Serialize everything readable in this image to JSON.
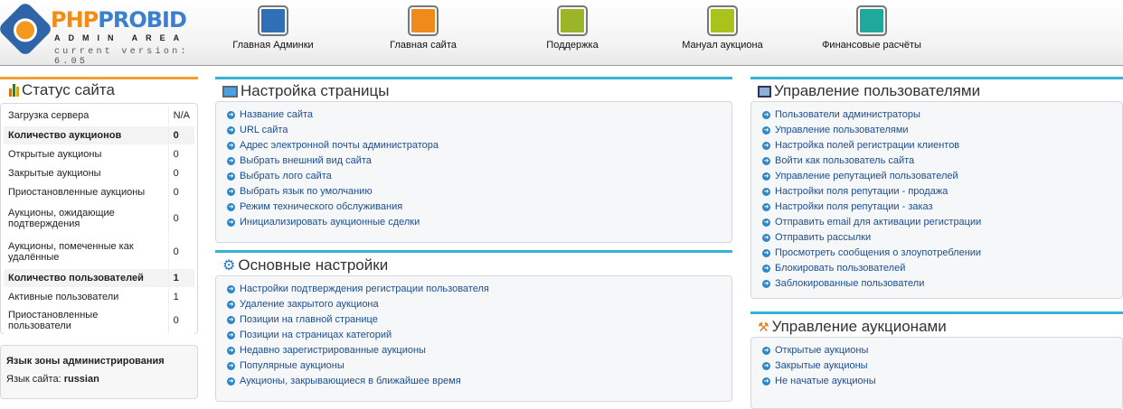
{
  "logo": {
    "brand_a": "PHP",
    "brand_b": "PROBID",
    "subtitle": "ADMIN AREA",
    "version": "current version: 6.05"
  },
  "nav": [
    {
      "label": "Главная Админки",
      "icon": "admin-user-icon",
      "color": "#2f6fb5"
    },
    {
      "label": "Главная сайта",
      "icon": "site-tools-icon",
      "color": "#f08a1a"
    },
    {
      "label": "Поддержка",
      "icon": "support-icon",
      "color": "#9bb52a"
    },
    {
      "label": "Мануал аукциона",
      "icon": "manual-bulb-icon",
      "color": "#a9c21c"
    },
    {
      "label": "Финансовые расчёты",
      "icon": "finance-bag-icon",
      "color": "#1fa99a"
    }
  ],
  "status": {
    "title": "Статус сайта",
    "rows": [
      {
        "label": "Загрузка сервера",
        "value": "N/A",
        "bold": false
      },
      {
        "label": "Количество аукционов",
        "value": "0",
        "bold": true
      },
      {
        "label": "Открытые аукционы",
        "value": "0",
        "bold": false
      },
      {
        "label": "Закрытые аукционы",
        "value": "0",
        "bold": false
      },
      {
        "label": "Приостановленные аукционы",
        "value": "0",
        "bold": false
      },
      {
        "label": "Аукционы, ожидающие подтверждения",
        "value": "0",
        "bold": false
      },
      {
        "label": "Аукционы, помеченные как удалённые",
        "value": "0",
        "bold": false
      },
      {
        "label": "Количество пользователей",
        "value": "1",
        "bold": true
      },
      {
        "label": "Активные пользователи",
        "value": "1",
        "bold": false
      },
      {
        "label": "Приостановленные пользователи",
        "value": "0",
        "bold": false
      }
    ]
  },
  "language": {
    "title": "Язык зоны администрирования",
    "label": "Язык сайта:",
    "value": "russian"
  },
  "page_setup": {
    "title": "Настройка страницы",
    "items": [
      "Название сайта",
      "URL сайта",
      "Адрес электронной почты администратора",
      "Выбрать внешний вид сайта",
      "Выбрать лого сайта",
      "Выбрать язык по умолчанию",
      "Режим технического обслуживания",
      "Инициализировать аукционные сделки"
    ]
  },
  "main_settings": {
    "title": "Основные настройки",
    "items": [
      "Настройки подтверждения регистрации пользователя",
      "Удаление закрытого аукциона",
      "Позиции на главной странице",
      "Позиции на страницах категорий",
      "Недавно зарегистрированные аукционы",
      "Популярные аукционы",
      "Аукционы, закрывающиеся в ближайшее время"
    ]
  },
  "users": {
    "title": "Управление пользователями",
    "items": [
      "Пользователи администраторы",
      "Управление пользователями",
      "Настройка полей регистрации клиентов",
      "Войти как пользователь сайта",
      "Управление репутацией пользователей",
      "Настройки поля репутации - продажа",
      "Настройки поля репутации - заказ",
      "Отправить email для активации регистрации",
      "Отправить рассылки",
      "Просмотреть сообщения о злоупотреблении",
      "Блокировать пользователей",
      "Заблокированные пользователи"
    ]
  },
  "auctions": {
    "title": "Управление аукционами",
    "items": [
      "Открытые аукционы",
      "Закрытые аукционы",
      "Не начатые аукционы"
    ]
  }
}
